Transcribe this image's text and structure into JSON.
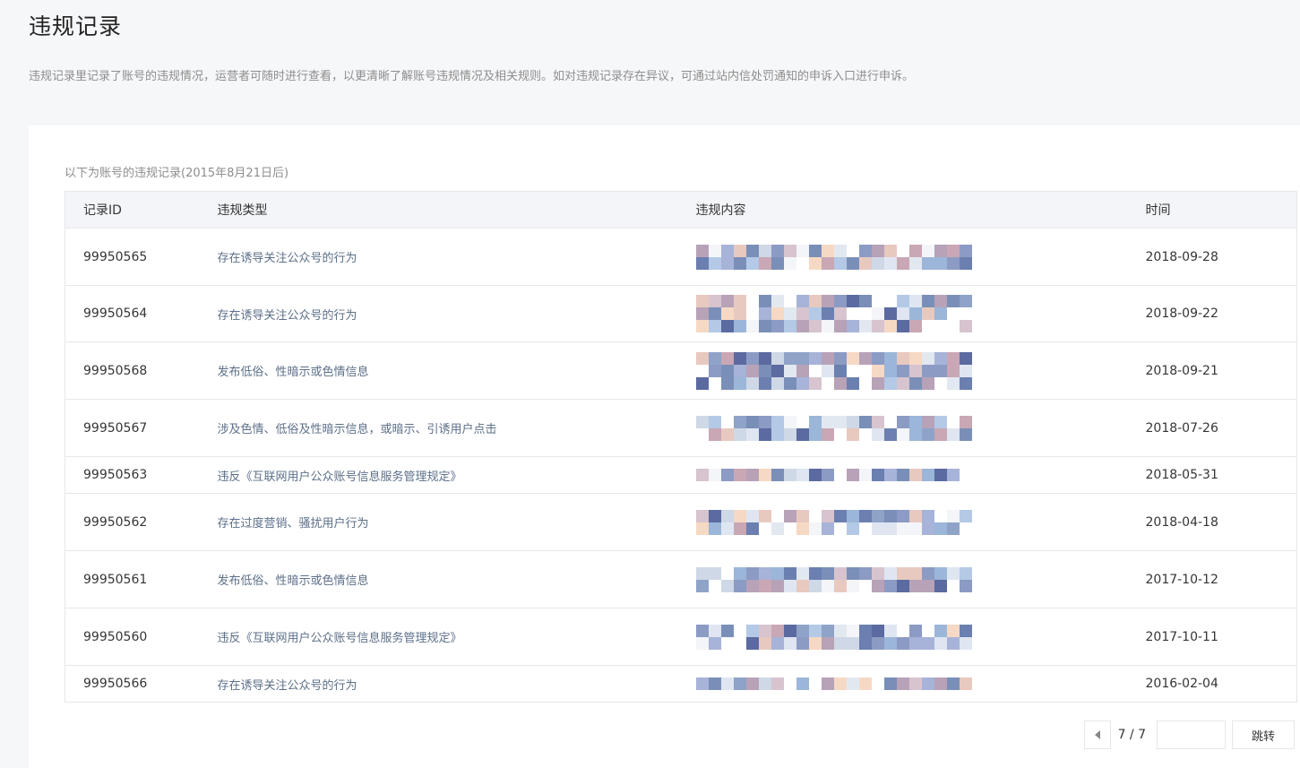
{
  "page": {
    "title": "违规记录",
    "description": "违规记录里记录了账号的违规情况，运营者可随时进行查看，以更清晰了解账号违规情况及相关规则。如对违规记录存在异议，可通过站内信处罚通知的申诉入口进行申诉。"
  },
  "table": {
    "caption": "以下为账号的违规记录(2015年8月21日后)",
    "headers": {
      "id": "记录ID",
      "type": "违规类型",
      "content": "违规内容",
      "time": "时间"
    },
    "rows": [
      {
        "id": "99950565",
        "type": "存在诱导关注公众号的行为",
        "time": "2018-09-28"
      },
      {
        "id": "99950564",
        "type": "存在诱导关注公众号的行为",
        "time": "2018-09-22"
      },
      {
        "id": "99950568",
        "type": "发布低俗、性暗示或色情信息",
        "time": "2018-09-21"
      },
      {
        "id": "99950567",
        "type": "涉及色情、低俗及性暗示信息，或暗示、引诱用户点击",
        "time": "2018-07-26"
      },
      {
        "id": "99950563",
        "type": "违反《互联网用户公众账号信息服务管理规定》",
        "time": "2018-05-31"
      },
      {
        "id": "99950562",
        "type": "存在过度营销、骚扰用户行为",
        "time": "2018-04-18"
      },
      {
        "id": "99950561",
        "type": "发布低俗、性暗示或色情信息",
        "time": "2017-10-12"
      },
      {
        "id": "99950560",
        "type": "违反《互联网用户公众账号信息服务管理规定》",
        "time": "2017-10-11"
      },
      {
        "id": "99950566",
        "type": "存在诱导关注公众号的行为",
        "time": "2016-02-04"
      }
    ]
  },
  "pager": {
    "page_indicator": "7 / 7",
    "jump_value": "",
    "jump_label": "跳转",
    "prev_icon": "chevron-left-icon"
  },
  "colors": {
    "background": "#f6f7f9",
    "panel": "#ffffff",
    "header_bg": "#f4f5f9",
    "border": "#e7e7eb",
    "type_text": "#5c6f88",
    "muted_text": "#8d8d8d"
  }
}
